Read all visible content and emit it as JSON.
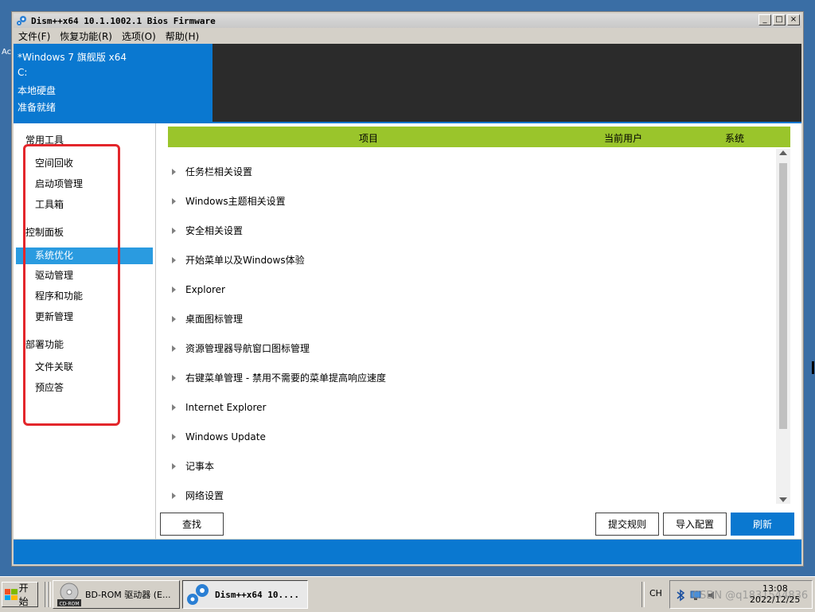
{
  "desktop": {
    "label_fragment": "Ac"
  },
  "window": {
    "title": "Dism++x64 10.1.1002.1 Bios Firmware",
    "menu": [
      "文件(F)",
      "恢复功能(R)",
      "选项(O)",
      "帮助(H)"
    ]
  },
  "info": {
    "os": "*Windows 7 旗舰版 x64",
    "drive": "C:",
    "disk_type": "本地硬盘",
    "status": "准备就绪"
  },
  "sidebar": {
    "sections": [
      {
        "title": "常用工具",
        "items": [
          "空间回收",
          "启动项管理",
          "工具箱"
        ]
      },
      {
        "title": "控制面板",
        "items": [
          "系统优化",
          "驱动管理",
          "程序和功能",
          "更新管理"
        ]
      },
      {
        "title": "部署功能",
        "items": [
          "文件关联",
          "预应答"
        ]
      }
    ],
    "selected": "系统优化"
  },
  "table": {
    "headers": {
      "item": "项目",
      "current_user": "当前用户",
      "system": "系统"
    },
    "rows": [
      "任务栏相关设置",
      "Windows主题相关设置",
      "安全相关设置",
      "开始菜单以及Windows体验",
      "Explorer",
      "桌面图标管理",
      "资源管理器导航窗口图标管理",
      "右键菜单管理 - 禁用不需要的菜单提高响应速度",
      "Internet Explorer",
      "Windows Update",
      "记事本",
      "网络设置"
    ]
  },
  "buttons": {
    "find": "查找",
    "submit_rules": "提交规则",
    "import_config": "导入配置",
    "refresh": "刷新"
  },
  "taskbar": {
    "start": "开始",
    "tasks": [
      {
        "label": "BD-ROM 驱动器 (E..."
      },
      {
        "label": "Dism++x64 10...."
      }
    ],
    "cdrom_label": "CD-ROM",
    "lang": "CH",
    "time": "13:08",
    "date": "2022/12/25",
    "watermark": "CSDN @q1831544836"
  },
  "colors": {
    "accent_blue": "#0a78d0",
    "header_green": "#9ac52b",
    "selection": "#2a9be0",
    "annotation_red": "#e3262b"
  }
}
